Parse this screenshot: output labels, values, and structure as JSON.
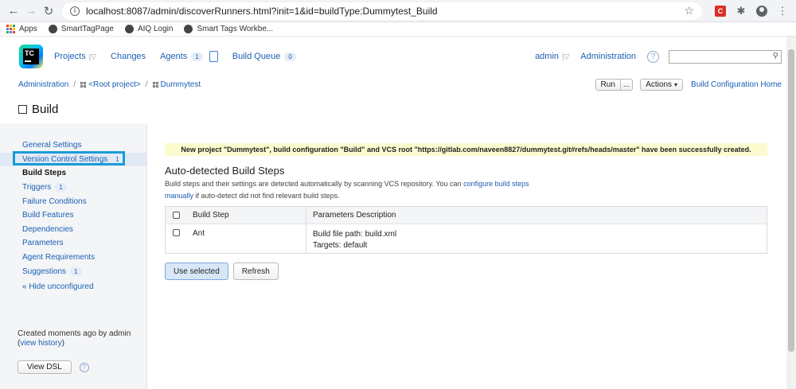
{
  "browser": {
    "url": "localhost:8087/admin/discoverRunners.html?init=1&id=buildType:Dummytest_Build",
    "bookmarks": [
      "Apps",
      "SmartTagPage",
      "AIQ Login",
      "Smart Tags Workbe..."
    ]
  },
  "header": {
    "logo_text": "TC",
    "nav": {
      "projects": "Projects",
      "changes": "Changes",
      "agents": "Agents",
      "agents_count": "1",
      "build_queue": "Build Queue",
      "build_queue_count": "0"
    },
    "user": "admin",
    "administration": "Administration",
    "search_placeholder": ""
  },
  "breadcrumb": {
    "administration": "Administration",
    "root_project": "<Root project>",
    "project": "Dummytest"
  },
  "toolbar": {
    "run": "Run",
    "run_more": "...",
    "actions": "Actions",
    "home_link": "Build Configuration Home"
  },
  "page_title": "Build",
  "sidebar": {
    "items": [
      {
        "label": "General Settings",
        "badge": ""
      },
      {
        "label": "Version Control Settings",
        "badge": "1"
      },
      {
        "label": "Build Steps",
        "badge": ""
      },
      {
        "label": "Triggers",
        "badge": "1"
      },
      {
        "label": "Failure Conditions",
        "badge": ""
      },
      {
        "label": "Build Features",
        "badge": ""
      },
      {
        "label": "Dependencies",
        "badge": ""
      },
      {
        "label": "Parameters",
        "badge": ""
      },
      {
        "label": "Agent Requirements",
        "badge": ""
      },
      {
        "label": "Suggestions",
        "badge": "1"
      }
    ],
    "hide_unconfigured": "« Hide unconfigured",
    "created": "Created moments ago by admin",
    "view_history_open": "(",
    "view_history": "view history",
    "view_history_close": ")",
    "view_dsl": "View DSL"
  },
  "main": {
    "alert": "New project \"Dummytest\", build configuration \"Build\" and VCS root \"https://gitlab.com/naveen8827/dummytest.git#refs/heads/master\" have been successfully created.",
    "heading": "Auto-detected Build Steps",
    "desc_part1": "Build steps and their settings are detected automatically by scanning VCS repository. You can",
    "desc_link1": "configure build steps",
    "desc_link2": "manually",
    "desc_part2": "if auto-detect did not find relevant build steps.",
    "table": {
      "headers": [
        "Build Step",
        "Parameters Description"
      ],
      "rows": [
        {
          "step": "Ant",
          "param1": "Build file path: build.xml",
          "param2": "Targets: default"
        }
      ]
    },
    "use_selected": "Use selected",
    "refresh": "Refresh"
  }
}
